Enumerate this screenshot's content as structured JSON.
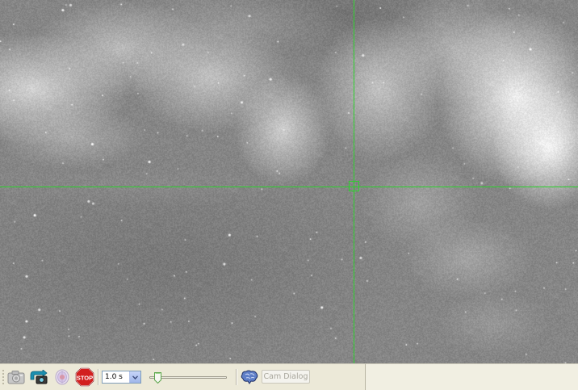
{
  "crosshair": {
    "color": "#2dd02d"
  },
  "sky_image": {
    "description_free": true
  },
  "toolbar": {
    "tools": [
      {
        "name": "camera-icon",
        "enabled": false
      },
      {
        "name": "loop-capture-icon",
        "enabled": true
      },
      {
        "name": "guide-target-icon",
        "enabled": false
      },
      {
        "name": "stop-icon",
        "enabled": true,
        "label": "STOP"
      }
    ],
    "exposure": {
      "value": "1.0 s"
    },
    "gain_slider": {
      "level": 0.1
    },
    "brain_icon": "brain-icon",
    "cam_dialog_label": "Cam Dialog",
    "colors": {
      "bar": "#ece9d8",
      "stop": "#d21f1f",
      "combo_border": "#7f9db9"
    }
  }
}
